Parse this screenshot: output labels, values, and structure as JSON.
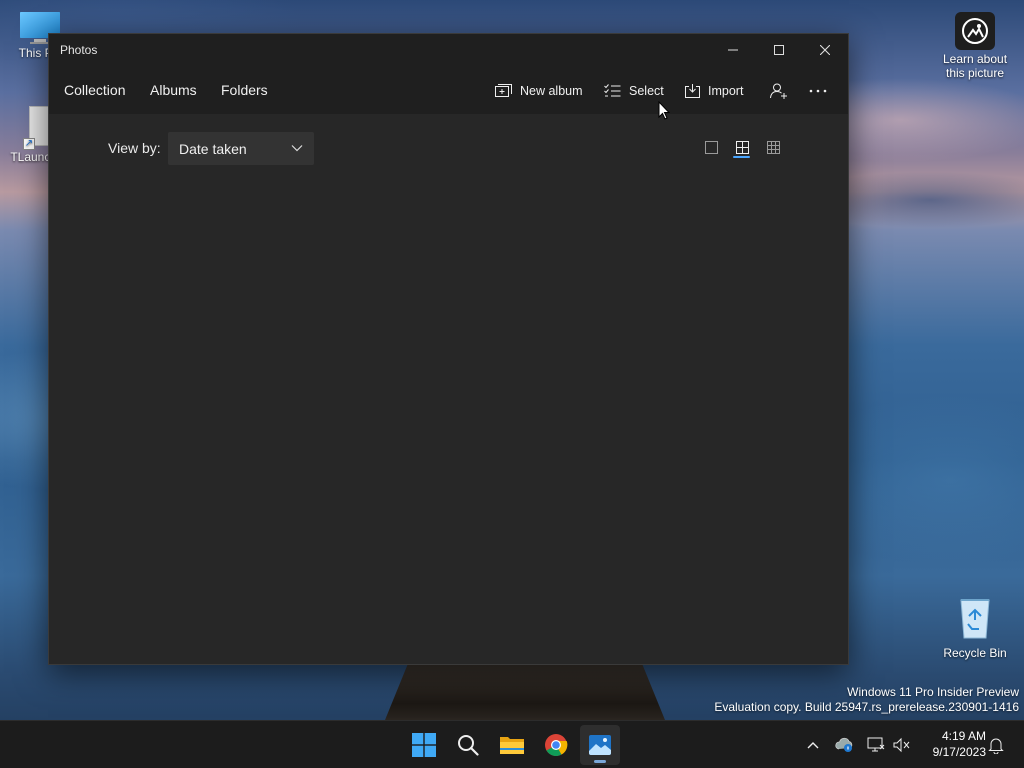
{
  "desktop": {
    "icons": [
      {
        "label": "This PC"
      },
      {
        "label": "TLauncher"
      },
      {
        "label": "Recycle Bin"
      },
      {
        "label": "Learn about this picture"
      }
    ],
    "watermark": {
      "line1": "Windows 11 Pro Insider Preview",
      "line2": "Evaluation copy. Build 25947.rs_prerelease.230901-1416"
    }
  },
  "window": {
    "title": "Photos",
    "nav": [
      "Collection",
      "Albums",
      "Folders"
    ],
    "commands": {
      "new_album": "New album",
      "select": "Select",
      "import": "Import"
    },
    "view_by_label": "View by:",
    "view_by_value": "Date taken",
    "layout_selected": "medium-grid"
  },
  "taskbar": {
    "clock_time": "4:19 AM",
    "clock_date": "9/17/2023",
    "apps": [
      "start",
      "search",
      "file-explorer",
      "chrome",
      "photos"
    ],
    "active_app": "photos"
  },
  "colors": {
    "window_bg": "#272727",
    "titlebar_bg": "#1f1f1f",
    "accent": "#4aa6ff",
    "taskbar_bg": "#1c1c1c"
  }
}
